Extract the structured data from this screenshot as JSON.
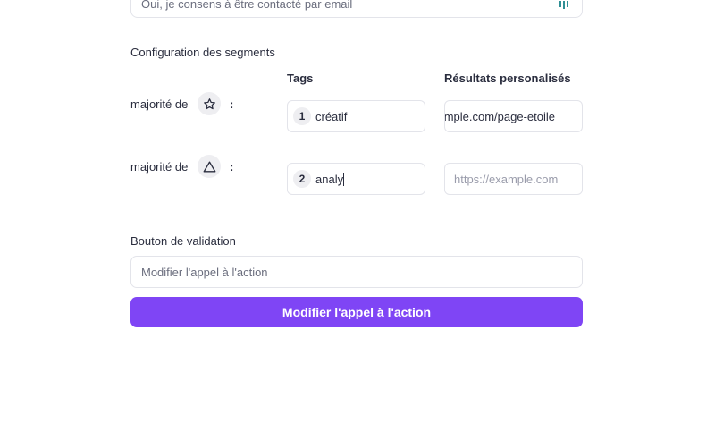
{
  "consent": {
    "value": "Oui, je consens à être contacté par email",
    "icon": "password-manager-icon"
  },
  "segments": {
    "section_label": "Configuration des segments",
    "col_tags": "Tags",
    "col_results": "Résultats personalisés",
    "rows": [
      {
        "label": "majorité de",
        "icon": "star-icon",
        "colon": ":",
        "tag_number": "1",
        "tag_value": "créatif",
        "url_value": "https://example.com/page-etoile",
        "url_placeholder": ""
      },
      {
        "label": "majorité de",
        "icon": "triangle-icon",
        "colon": ":",
        "tag_number": "2",
        "tag_value": "analy",
        "url_value": "",
        "url_placeholder": "https://example.com"
      }
    ]
  },
  "validation": {
    "label": "Bouton de validation",
    "input_value": "Modifier l'appel à l'action",
    "button_label": "Modifier l'appel à l'action"
  },
  "colors": {
    "accent": "#7f45f5",
    "text": "#2a2d3e",
    "border": "#e3e4ea"
  }
}
